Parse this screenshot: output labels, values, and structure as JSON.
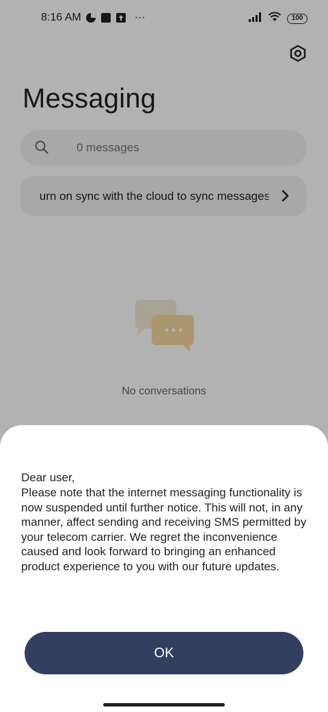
{
  "status_bar": {
    "time": "8:16 AM",
    "battery": "100",
    "more": "···",
    "icons": [
      "data-saver-icon",
      "square-notification-icon",
      "upload-icon",
      "signal-icon",
      "wifi-icon",
      "battery-icon"
    ]
  },
  "header": {
    "title": "Messaging",
    "settings_icon": "settings-icon"
  },
  "search": {
    "placeholder": "0 messages"
  },
  "sync_banner": {
    "text": "Turn on sync with the cloud to sync messages"
  },
  "empty_state": {
    "label": "No conversations"
  },
  "dialog": {
    "greeting": "Dear user,",
    "body": "Please note that the internet messaging functionality is now suspended until further notice. This will not, in any manner, affect sending and receiving SMS permitted by your telecom carrier. We regret the inconvenience caused and look forward to bringing an enhanced product experience to you with our future updates.",
    "ok_label": "OK"
  },
  "colors": {
    "accent": "#323f60",
    "scrim": "rgba(0,0,0,0.30)",
    "bubble_back": "#f3e8d6",
    "bubble_front": "#f7d79e"
  }
}
